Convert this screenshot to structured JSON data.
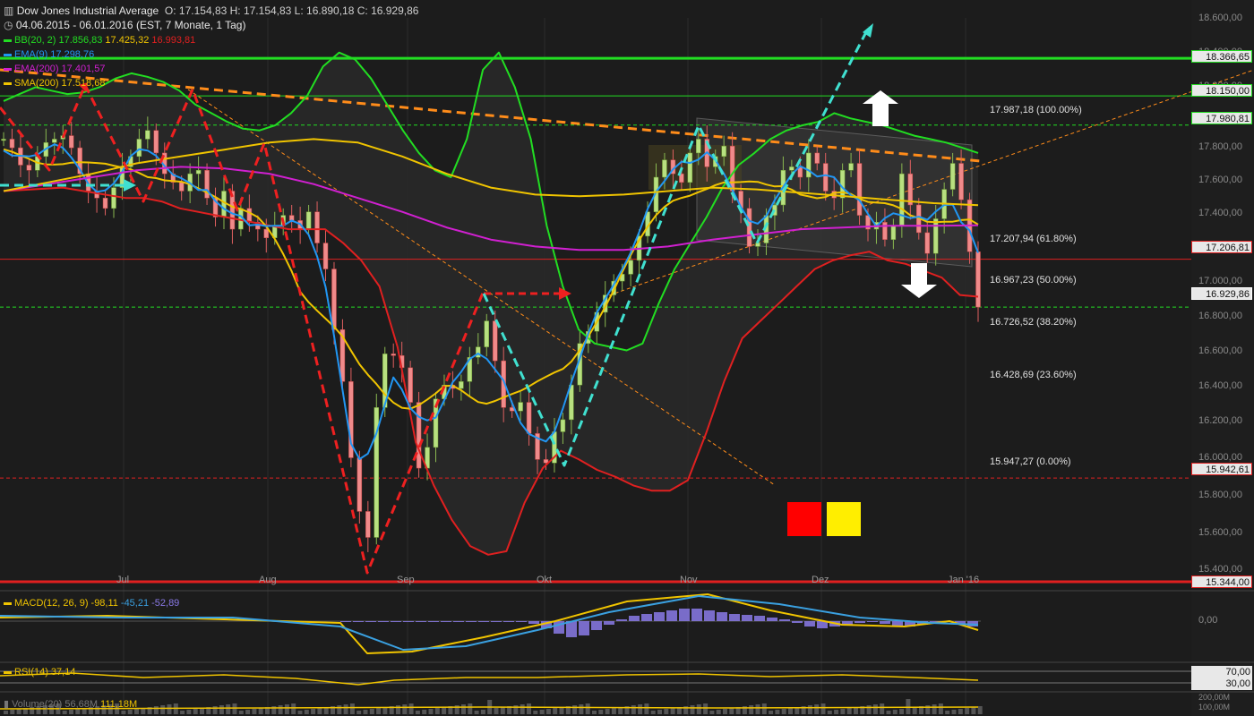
{
  "header": {
    "title": "Dow Jones Industrial Average",
    "ohlc": "O: 17.154,83  H: 17.154,83  L: 16.890,18  C: 16.929,86",
    "range": "04.06.2015 - 06.01.2016 (EST, 7 Monate, 1 Tag)"
  },
  "indicators": {
    "bb": {
      "label": "BB(20, 2)",
      "v1": "17.856,83",
      "v2": "17.425,32",
      "v3": "16.993,81",
      "color_upper": "#22dd22",
      "color_mid": "#f0c400",
      "color_lower": "#e02020"
    },
    "ema9": {
      "label": "EMA(9)",
      "v": "17.298,76",
      "color": "#2196f3"
    },
    "ema200": {
      "label": "EMA(200)",
      "v": "17.401,57",
      "color": "#d020d0"
    },
    "sma200": {
      "label": "SMA(200)",
      "v": "17.518,68",
      "color": "#f0c400"
    }
  },
  "price_tags": {
    "t1": {
      "value": "18.366,65",
      "color": "#22dd22"
    },
    "t2": {
      "value": "18.150,00",
      "color": "#22dd22"
    },
    "t3": {
      "value": "17.980,81",
      "color": "#22dd22"
    },
    "t4": {
      "value": "17.206,81",
      "color": "#e02020"
    },
    "t5": {
      "value": "16.929,86",
      "color": "#ffffff"
    },
    "t6": {
      "value": "15.942,61",
      "color": "#e02020"
    },
    "t7": {
      "value": "15.344,00",
      "color": "#e02020"
    }
  },
  "y_ticks": [
    "18.600,00",
    "18.400,00",
    "18.200,00",
    "17.800,00",
    "17.600,00",
    "17.400,00",
    "17.000,00",
    "16.800,00",
    "16.600,00",
    "16.400,00",
    "16.200,00",
    "16.000,00",
    "15.800,00",
    "15.600,00",
    "15.400,00"
  ],
  "fib_labels": {
    "f100": "17.987,18 (100.00%)",
    "f618": "17.207,94 (61.80%)",
    "f50": "16.967,23 (50.00%)",
    "f382": "16.726,52 (38.20%)",
    "f236": "16.428,69 (23.60%)",
    "f0": "15.947,27 (0.00%)"
  },
  "x_labels": {
    "jul": "Jul",
    "aug": "Aug",
    "sep": "Sep",
    "okt": "Okt",
    "nov": "Nov",
    "dez": "Dez",
    "jan": "Jan '16"
  },
  "macd": {
    "label": "MACD(12, 26, 9)",
    "v1": "-98,11",
    "v2": "-45,21",
    "v3": "-52,89",
    "zero": "0,00"
  },
  "rsi": {
    "label": "RSI(14)",
    "v": "37,14",
    "hi": "70,00",
    "lo": "30,00"
  },
  "volume": {
    "label": "Volume(20)",
    "v1": "56,68M",
    "v2": "111,18M",
    "t1": "200,00M",
    "t2": "100,00M"
  },
  "chart_data": {
    "type": "candlestick",
    "instrument": "Dow Jones Industrial Average",
    "period": "04.06.2015 - 06.01.2016",
    "ylim": [
      15344,
      18600
    ],
    "closes_approx": [
      17900,
      17850,
      17750,
      17720,
      17800,
      17880,
      17900,
      17920,
      17850,
      17700,
      17600,
      17560,
      17500,
      17620,
      17740,
      17800,
      17900,
      17950,
      17820,
      17700,
      17650,
      17600,
      17700,
      17720,
      17560,
      17450,
      17600,
      17380,
      17500,
      17420,
      17380,
      17330,
      17400,
      17460,
      17430,
      17380,
      17480,
      17300,
      17150,
      16800,
      16500,
      16060,
      15750,
      15600,
      16350,
      16660,
      16650,
      16580,
      16380,
      16000,
      16120,
      16400,
      16480,
      16460,
      16500,
      16640,
      16700,
      16850,
      16620,
      16350,
      16330,
      16380,
      16200,
      16050,
      16030,
      16210,
      16280,
      16480,
      16720,
      16790,
      16900,
      17000,
      17080,
      17120,
      17200,
      17340,
      17480,
      17680,
      17780,
      17700,
      17650,
      17820,
      17900,
      17740,
      17800,
      17860,
      17600,
      17500,
      17280,
      17300,
      17460,
      17520,
      17720,
      17740,
      17680,
      17820,
      17760,
      17600,
      17560,
      17720,
      17760,
      17460,
      17380,
      17420,
      17320,
      17400,
      17700,
      17520,
      17360,
      17240,
      17440,
      17610,
      17760,
      17550,
      17250,
      16930
    ],
    "bb_upper_approx": [
      18120,
      18160,
      18200,
      18180,
      18160,
      18170,
      18200,
      18250,
      18280,
      18260,
      18230,
      18180,
      18100,
      18050,
      18000,
      17960,
      17950,
      17980,
      18050,
      18150,
      18320,
      18400,
      18360,
      18250,
      18100,
      17950,
      17820,
      17720,
      17680,
      17900,
      18300,
      18400,
      18200,
      17900,
      17400,
      17050,
      16800,
      16720,
      16700,
      16680,
      16720,
      16950,
      17150,
      17300,
      17450,
      17620,
      17750,
      17820,
      17900,
      17950,
      17980,
      18000,
      18050,
      18020,
      18000,
      17980,
      17950,
      17920,
      17900,
      17880,
      17850,
      17820
    ],
    "bb_lower_approx": [
      17560,
      17560,
      17540,
      17500,
      17480,
      17460,
      17440,
      17420,
      17400,
      17380,
      17380,
      17380,
      17300,
      17200,
      17050,
      16700,
      16150,
      15900,
      15700,
      15550,
      15500,
      15520,
      15800,
      16000,
      16100,
      16050,
      15990,
      15950,
      15900,
      15870,
      15870,
      15930,
      16200,
      16500,
      16750,
      16850,
      16950,
      17050,
      17150,
      17200,
      17230,
      17250,
      17200,
      17180,
      17140,
      17100,
      17000,
      16990
    ],
    "annotations": {
      "fibonacci": [
        {
          "level": "100.00%",
          "value": 17987.18
        },
        {
          "level": "61.80%",
          "value": 17207.94
        },
        {
          "level": "50.00%",
          "value": 16967.23
        },
        {
          "level": "38.20%",
          "value": 16726.52
        },
        {
          "level": "23.60%",
          "value": 16428.69
        },
        {
          "level": "0.00%",
          "value": 15947.27
        }
      ],
      "horizontal_lines": [
        18366.65,
        18150.0,
        17980.81,
        17206.81,
        16929.86,
        15942.61,
        15344.0
      ]
    },
    "x_tick_labels": [
      "Jul",
      "Aug",
      "Sep",
      "Okt",
      "Nov",
      "Dez",
      "Jan '16"
    ]
  }
}
